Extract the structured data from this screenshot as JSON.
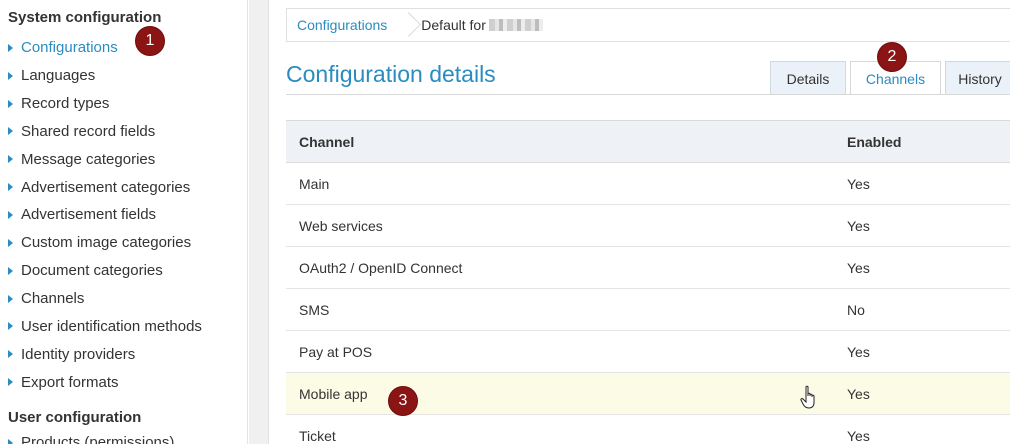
{
  "sidebar": {
    "section1_title": "System configuration",
    "items": [
      {
        "label": "Configurations",
        "active": true
      },
      {
        "label": "Languages"
      },
      {
        "label": "Record types"
      },
      {
        "label": "Shared record fields"
      },
      {
        "label": "Message categories"
      },
      {
        "label": "Advertisement categories"
      },
      {
        "label": "Advertisement fields"
      },
      {
        "label": "Custom image categories"
      },
      {
        "label": "Document categories"
      },
      {
        "label": "Channels"
      },
      {
        "label": "User identification methods"
      },
      {
        "label": "Identity providers"
      },
      {
        "label": "Export formats"
      }
    ],
    "section2_title": "User configuration",
    "section2_first_item": "Products (permissions)"
  },
  "breadcrumb": {
    "link": "Configurations",
    "current": "Default for"
  },
  "page": {
    "title": "Configuration details",
    "tabs": [
      "Details",
      "Channels",
      "History"
    ],
    "active_tab": "Channels"
  },
  "table": {
    "headers": [
      "Channel",
      "Enabled"
    ],
    "rows": [
      [
        "Main",
        "Yes"
      ],
      [
        "Web services",
        "Yes"
      ],
      [
        "OAuth2 / OpenID Connect",
        "Yes"
      ],
      [
        "SMS",
        "No"
      ],
      [
        "Pay at POS",
        "Yes"
      ],
      [
        "Mobile app",
        "Yes"
      ],
      [
        "Ticket",
        "Yes"
      ]
    ],
    "hovered_row": "Mobile app"
  },
  "markers": [
    "1",
    "2",
    "3"
  ],
  "colors": {
    "accent": "#2a8cc0",
    "marker": "#8b1414",
    "header_bg": "#eef2f6",
    "hover_bg": "#fcfce6",
    "tab_bg": "#eaf1f8"
  },
  "icons": {
    "sidebar_bullet": "caret-right-icon",
    "cursor": "hand-pointer-icon"
  }
}
